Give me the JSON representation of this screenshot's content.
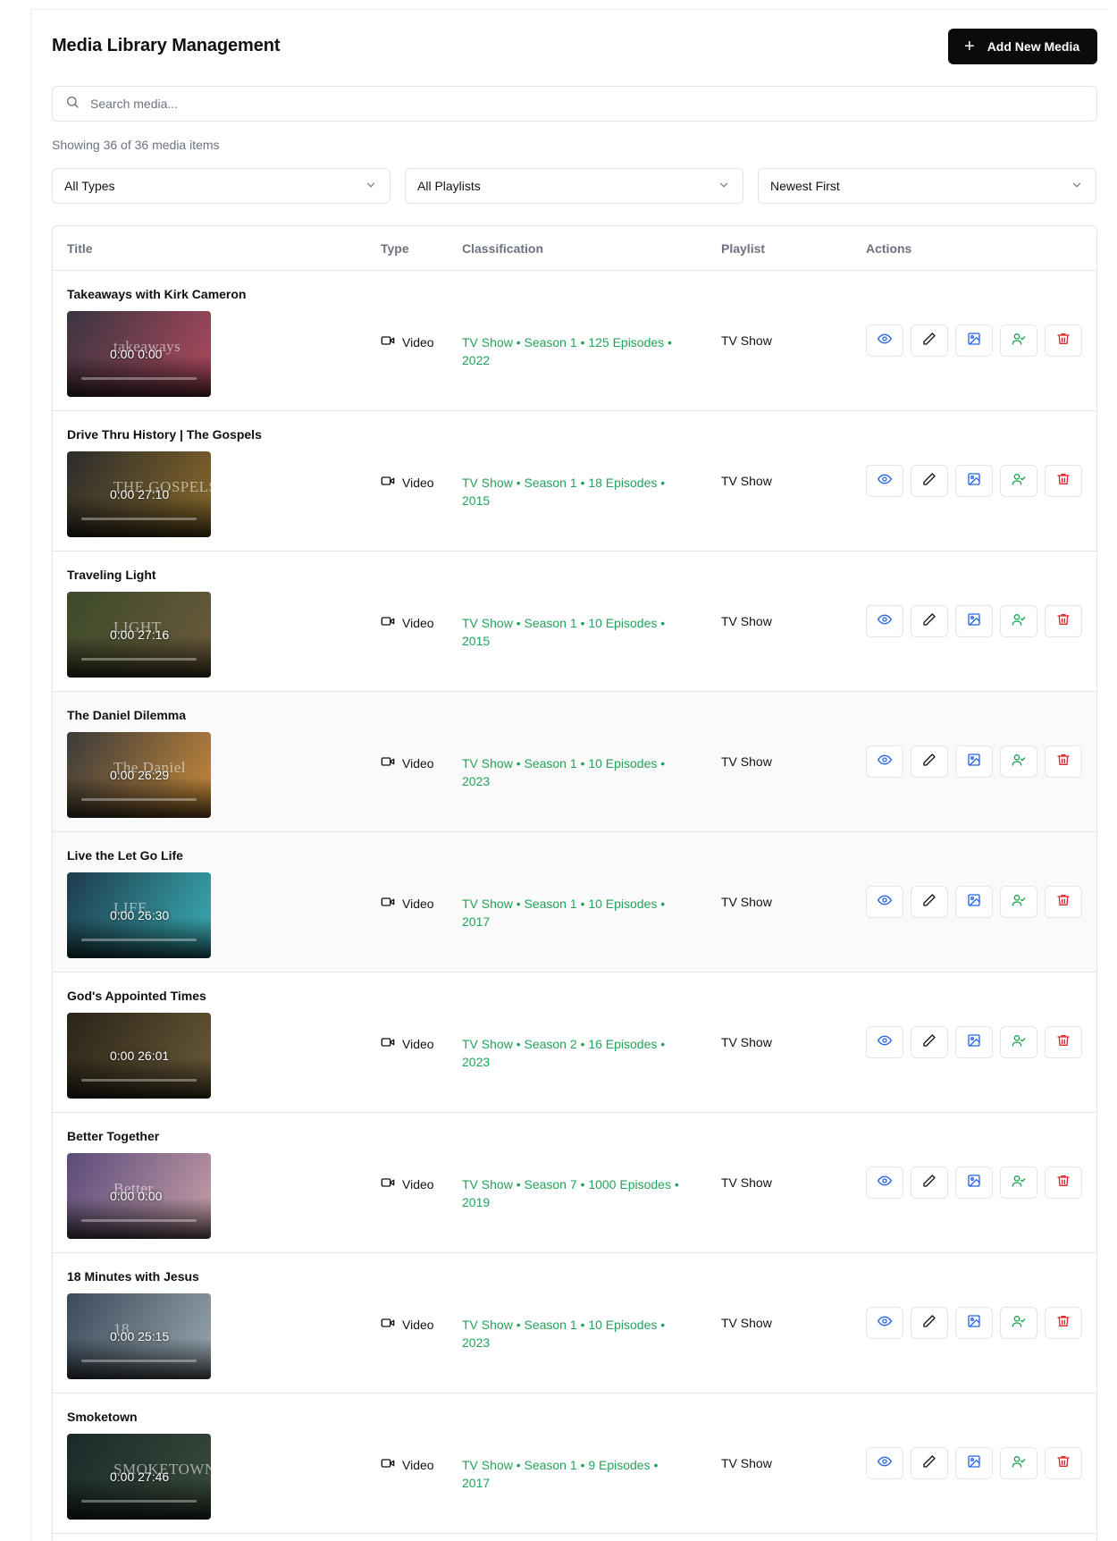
{
  "header": {
    "title": "Media Library Management",
    "add_label": "Add New Media"
  },
  "search": {
    "placeholder": "Search media..."
  },
  "count_text": "Showing 36 of 36 media items",
  "filters": {
    "type": "All Types",
    "playlist": "All Playlists",
    "sort": "Newest First"
  },
  "table": {
    "columns": {
      "title": "Title",
      "type": "Type",
      "classification": "Classification",
      "playlist": "Playlist",
      "actions": "Actions"
    },
    "rows": [
      {
        "title": "Takeaways with Kirk Cameron",
        "logo": "takeaways",
        "time": "0:00 0:00",
        "type": "Video",
        "classification": "TV Show • Season 1 • 125 Episodes • 2022",
        "playlist": "TV Show",
        "c1": "#3a3440",
        "c2": "#b04a5e"
      },
      {
        "title": "Drive Thru History | The Gospels",
        "logo": "THE GOSPELS",
        "time": "0:00 27:10",
        "type": "Video",
        "classification": "TV Show • Season 1 • 18 Episodes • 2015",
        "playlist": "TV Show",
        "c1": "#2b2b2b",
        "c2": "#8a6a2a"
      },
      {
        "title": "Traveling Light",
        "logo": "LIGHT",
        "time": "0:00 27:16",
        "type": "Video",
        "classification": "TV Show • Season 1 • 10 Episodes • 2015",
        "playlist": "TV Show",
        "c1": "#3c4a2a",
        "c2": "#6b5a3a"
      },
      {
        "title": "The Daniel Dilemma",
        "logo": "The Daniel",
        "time": "0:00 26:29",
        "type": "Video",
        "classification": "TV Show • Season 1 • 10 Episodes • 2023",
        "playlist": "TV Show",
        "c1": "#3a3a3a",
        "c2": "#c98a3a"
      },
      {
        "title": "Live the Let Go Life",
        "logo": "LIFE",
        "time": "0:00 26:30",
        "type": "Video",
        "classification": "TV Show • Season 1 • 10 Episodes • 2017",
        "playlist": "TV Show",
        "c1": "#1d3a4a",
        "c2": "#3ab0b8"
      },
      {
        "title": "God's Appointed Times",
        "logo": "",
        "time": "0:00 26:01",
        "type": "Video",
        "classification": "TV Show • Season 2 • 16 Episodes • 2023",
        "playlist": "TV Show",
        "c1": "#2a2418",
        "c2": "#6a5a38"
      },
      {
        "title": "Better Together",
        "logo": "Better",
        "time": "0:00 0:00",
        "type": "Video",
        "classification": "TV Show • Season 7 • 1000 Episodes • 2019",
        "playlist": "TV Show",
        "c1": "#5a4a7a",
        "c2": "#c8a0a8"
      },
      {
        "title": "18 Minutes with Jesus",
        "logo": "18",
        "time": "0:00 25:15",
        "type": "Video",
        "classification": "TV Show • Season 1 • 10 Episodes • 2023",
        "playlist": "TV Show",
        "c1": "#3a4a5a",
        "c2": "#9aa8b0"
      },
      {
        "title": "Smoketown",
        "logo": "SMOKETOWN",
        "time": "0:00 27:46",
        "type": "Video",
        "classification": "TV Show • Season 1 • 9 Episodes • 2017",
        "playlist": "TV Show",
        "c1": "#1a2a2a",
        "c2": "#3a4a3a"
      }
    ]
  },
  "colors": {
    "view": "#2563eb",
    "edit": "#111111",
    "image": "#2563eb",
    "assign": "#16a34a",
    "delete": "#dc2626",
    "classification": "#22a35a"
  },
  "icons": [
    "search-icon",
    "chevron-down-icon",
    "plus-icon",
    "video-icon",
    "eye-icon",
    "pencil-icon",
    "image-icon",
    "user-check-icon",
    "trash-icon"
  ]
}
